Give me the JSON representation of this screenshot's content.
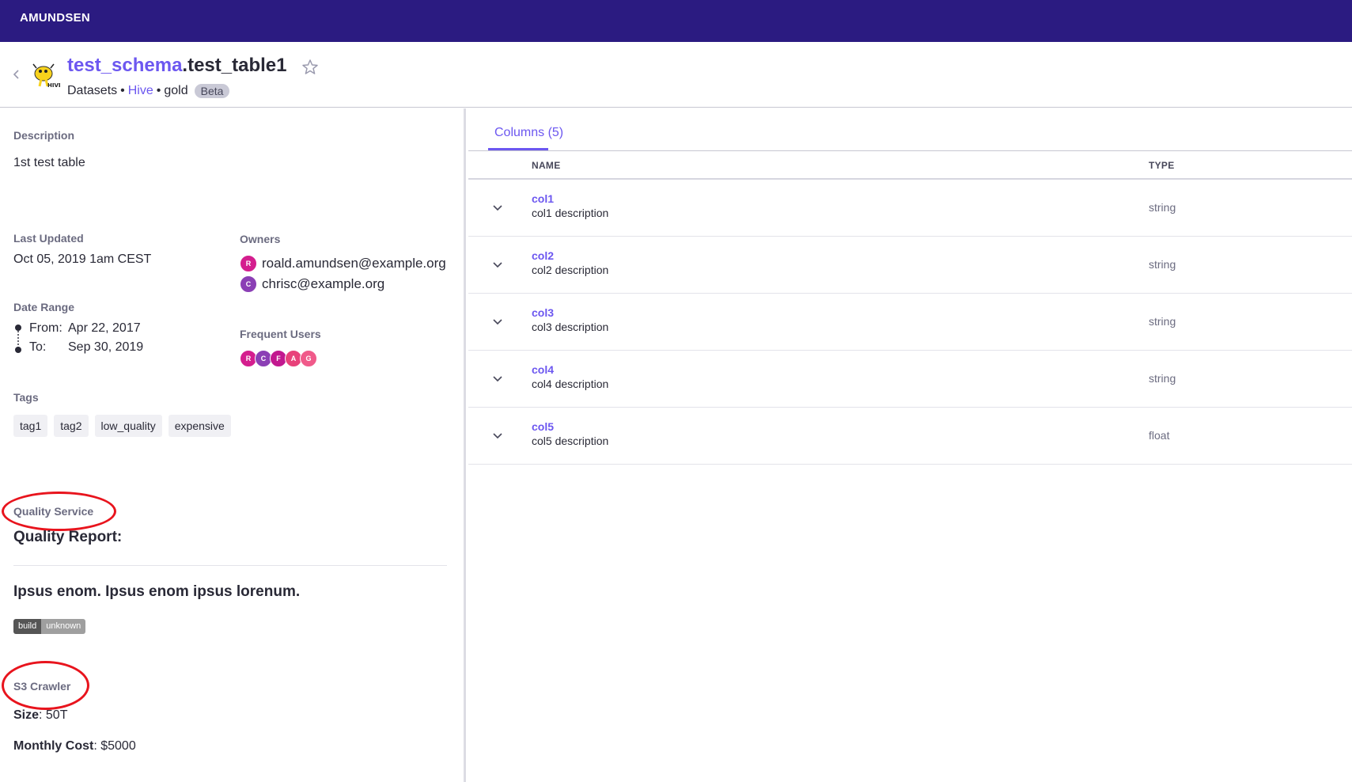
{
  "navbar": {
    "brand": "AMUNDSEN"
  },
  "header": {
    "schema": "test_schema",
    "dot": ".",
    "table": "test_table1",
    "crumb_datasets": "Datasets",
    "bullet": "•",
    "crumb_source": "Hive",
    "crumb_tier": "gold",
    "badge": "Beta"
  },
  "left": {
    "description_label": "Description",
    "description": "1st test table",
    "last_updated_label": "Last Updated",
    "last_updated": "Oct 05, 2019 1am CEST",
    "owners_label": "Owners",
    "owners": [
      {
        "initial": "R",
        "email": "roald.amundsen@example.org",
        "color": "#d41e8e"
      },
      {
        "initial": "C",
        "email": "chrisc@example.org",
        "color": "#8b3fb5"
      }
    ],
    "date_range_label": "Date Range",
    "from_label": "From:",
    "from_value": "Apr 22, 2017",
    "to_label": "To:",
    "to_value": "Sep 30, 2019",
    "frequent_users_label": "Frequent Users",
    "frequent_users": [
      {
        "initial": "R",
        "color": "#d41e8e"
      },
      {
        "initial": "C",
        "color": "#8b3fb5"
      },
      {
        "initial": "F",
        "color": "#c2188f"
      },
      {
        "initial": "A",
        "color": "#e8417a"
      },
      {
        "initial": "G",
        "color": "#f05a8a"
      }
    ],
    "tags_label": "Tags",
    "tags": [
      "tag1",
      "tag2",
      "low_quality",
      "expensive"
    ],
    "quality_service_label": "Quality Service",
    "quality_report": "Quality Report:",
    "quality_text": "Ipsus enom. Ipsus enom ipsus lorenum.",
    "build_badge_left": "build",
    "build_badge_right": "unknown",
    "s3_label": "S3 Crawler",
    "size_key": "Size",
    "size_value": ": 50T",
    "cost_key": "Monthly Cost",
    "cost_value": ": $5000",
    "annotation_color": "#e8141d"
  },
  "columns": {
    "tab_label": "Columns (5)",
    "header_name": "NAME",
    "header_type": "TYPE",
    "rows": [
      {
        "name": "col1",
        "description": "col1 description",
        "type": "string"
      },
      {
        "name": "col2",
        "description": "col2 description",
        "type": "string"
      },
      {
        "name": "col3",
        "description": "col3 description",
        "type": "string"
      },
      {
        "name": "col4",
        "description": "col4 description",
        "type": "string"
      },
      {
        "name": "col5",
        "description": "col5 description",
        "type": "float"
      }
    ]
  },
  "colors": {
    "brand": "#2b1b81",
    "accent": "#6c57f0"
  }
}
